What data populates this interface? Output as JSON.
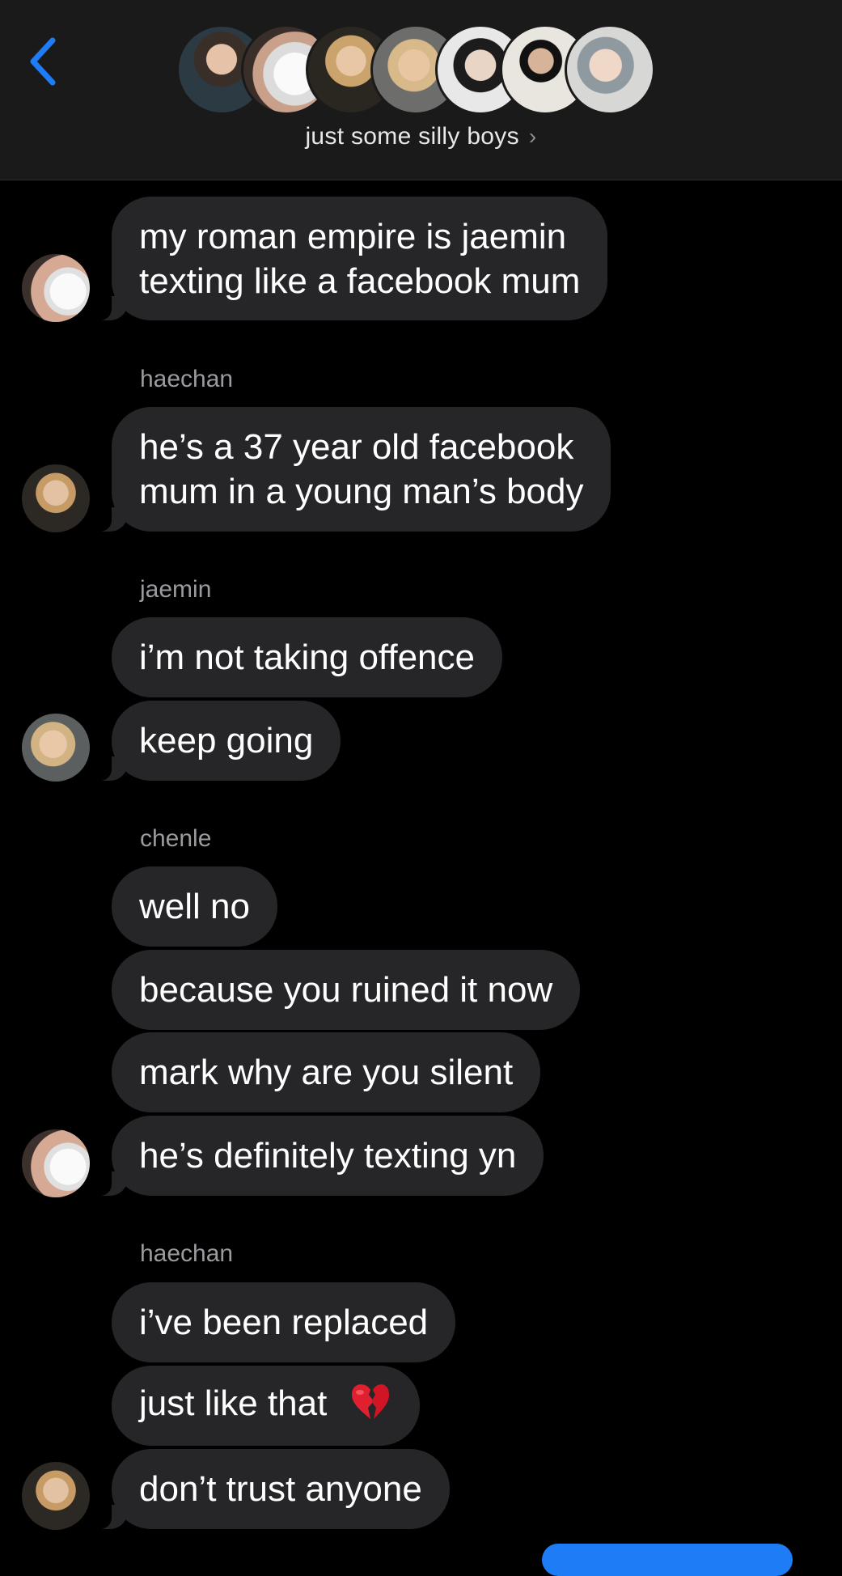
{
  "header": {
    "group_name": "just some silly boys",
    "chevron": "›"
  },
  "colors": {
    "accent": "#1e7cf7",
    "bubble": "#262629",
    "header_bg": "#1a1a1a"
  },
  "messages": {
    "m1": "my roman empire is jaemin",
    "m1b": "texting like a facebook mum",
    "s2": "haechan",
    "m2": "he’s a 37 year old facebook",
    "m2b": "mum in a young man’s body",
    "s3": "jaemin",
    "m3": "i’m not taking offence",
    "m4": "keep going",
    "s5": "chenle",
    "m5": "well no",
    "m6": "because you ruined it now",
    "m7": "mark why are you silent",
    "m8": "he’s definitely texting yn",
    "s9": "haechan",
    "m9": "i’ve been replaced",
    "m10": "just like that",
    "m11": "don’t trust anyone"
  },
  "icons": {
    "back": "chevron-left-icon",
    "heart": "broken-heart-icon"
  }
}
